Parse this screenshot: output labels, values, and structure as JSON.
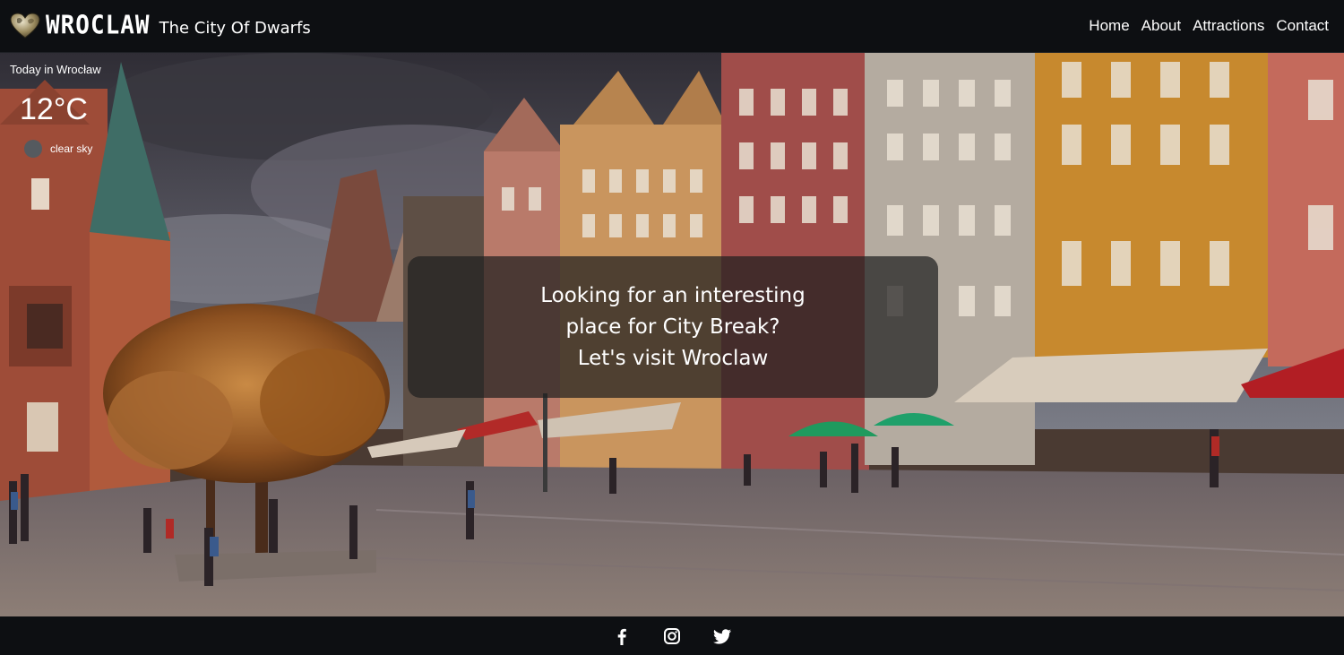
{
  "navbar": {
    "brand_name": "WROCLAW",
    "brand_tagline": "The City Of Dwarfs",
    "links": [
      {
        "label": "Home"
      },
      {
        "label": "About"
      },
      {
        "label": "Attractions"
      },
      {
        "label": "Contact"
      }
    ]
  },
  "weather": {
    "label": "Today in Wrocław",
    "temperature": "12°C",
    "description": "clear sky",
    "icon": "weather-icon"
  },
  "hero": {
    "headline_line1": "Looking for an interesting",
    "headline_line2": "place for City Break?",
    "headline_line3": "Let's visit Wroclaw",
    "background": "hdr-photo-of-wroclaw-market-square"
  },
  "footer": {
    "social": [
      {
        "icon": "facebook-icon"
      },
      {
        "icon": "instagram-icon"
      },
      {
        "icon": "twitter-icon"
      }
    ]
  },
  "colors": {
    "navbar_bg": "#0d0f12",
    "text": "#ffffff",
    "overlay": "#202020"
  }
}
